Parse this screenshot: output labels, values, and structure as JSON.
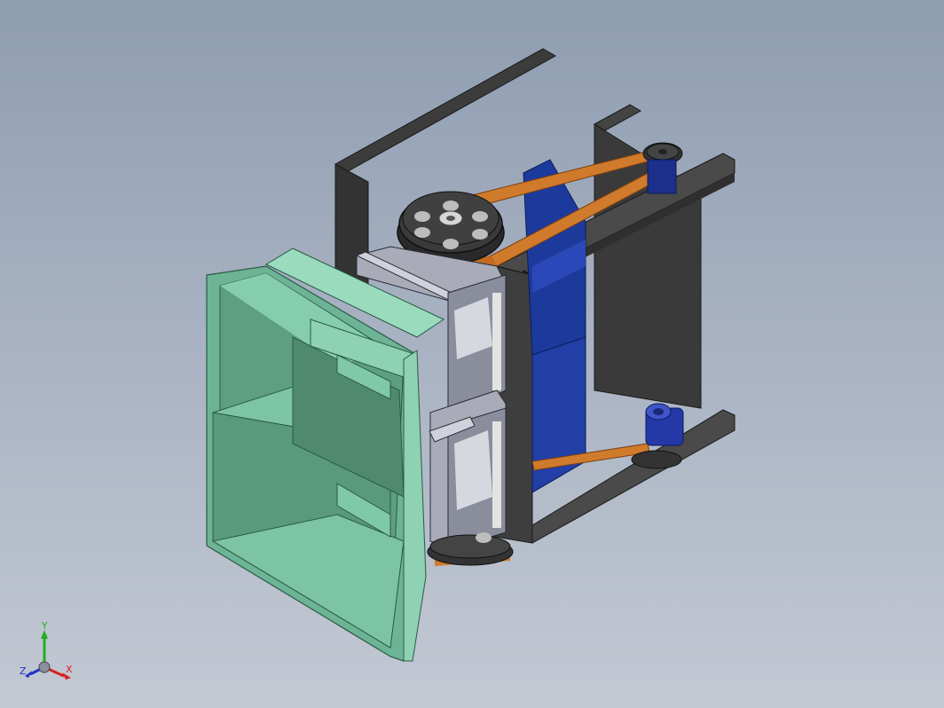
{
  "viewport": {
    "view": "isometric",
    "background_top": "#8f9db1",
    "background_bottom": "#c3c9d3"
  },
  "model": {
    "components": [
      {
        "name": "hopper",
        "color": "#7cc4a4"
      },
      {
        "name": "frame",
        "color": "#3a3a3a"
      },
      {
        "name": "drive-pulley",
        "color": "#2f2f2f"
      },
      {
        "name": "belt",
        "color": "#d47a2c"
      },
      {
        "name": "motor-housing",
        "color": "#1f3fa0"
      },
      {
        "name": "motor-small",
        "color": "#2a3fb0"
      },
      {
        "name": "blade-holder",
        "color": "#b9bcc8"
      }
    ]
  },
  "triad": {
    "x_label": "X",
    "y_label": "Y",
    "z_label": "Z",
    "x_color": "#d42020",
    "y_color": "#20b020",
    "z_color": "#2030c8"
  }
}
